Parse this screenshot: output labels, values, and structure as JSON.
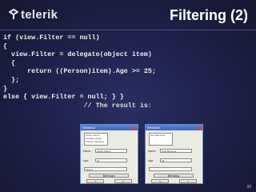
{
  "header": {
    "logo_text": "telerik",
    "title": "Filtering (2)"
  },
  "code_lines": [
    "if (view.Filter == null)",
    "{",
    "  view.Filter = delegate(object item)",
    "  {",
    "      return ((Person)item).Age >= 25;",
    "  };",
    "}",
    "else { view.Filter = null; } }",
    "                    // The result is:"
  ],
  "screenshots": [
    {
      "window_title": "Window1",
      "list_items": [
        "Hristo Ivanov",
        "Gergana Anger",
        "Plamen Atanasov"
      ],
      "name_label": "Name:",
      "name_value": "Hristo Ivanov",
      "age_label": "Age:",
      "age_value": "31",
      "combo_value": "Vihren",
      "birthday_button": "Birthday",
      "prev_button": "<",
      "next_button": ">"
    },
    {
      "window_title": "Window1",
      "list_items": [
        "Neli Marinova"
      ],
      "name_label": "Name:",
      "name_value": "Neli Marinova",
      "age_label": "Age:",
      "age_value": "29",
      "combo_value": "",
      "birthday_button": "Birthday",
      "prev_button": "<",
      "next_button": ">"
    }
  ],
  "page_number": "33",
  "colors": {
    "background": "#1f224b",
    "title": "#ffffff",
    "code": "#f2f2f2",
    "window_titlebar": "#3b66bb"
  }
}
